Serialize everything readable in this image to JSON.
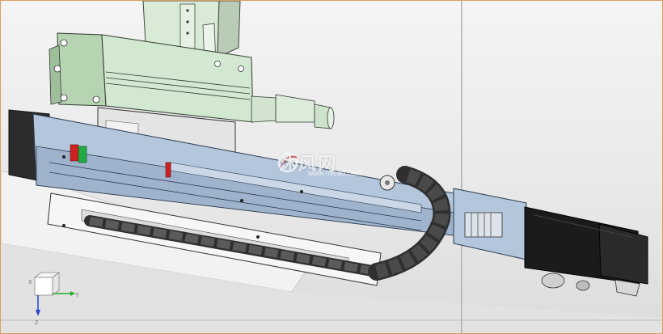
{
  "viewport": {
    "background_top": "#f4f4f4",
    "background_bottom": "#dcdcdc",
    "frame_color": "#d9a060"
  },
  "watermark": {
    "logo_icon": "mf-logo-icon",
    "text": "沐风网",
    "subtext": "www.mfcad.com"
  },
  "triad": {
    "x_label": "X",
    "y_label": "Y",
    "z_label": "Z",
    "x_color": "#cc3333",
    "y_color": "#22aa22",
    "z_color": "#2244cc"
  },
  "model": {
    "rail_color": "#a9bcd3",
    "block_color": "#c9dfc8",
    "motor_color": "#1b1b1b",
    "chain_color": "#3a3a3a",
    "accent_red": "#cc2222",
    "accent_green": "#22aa44"
  }
}
